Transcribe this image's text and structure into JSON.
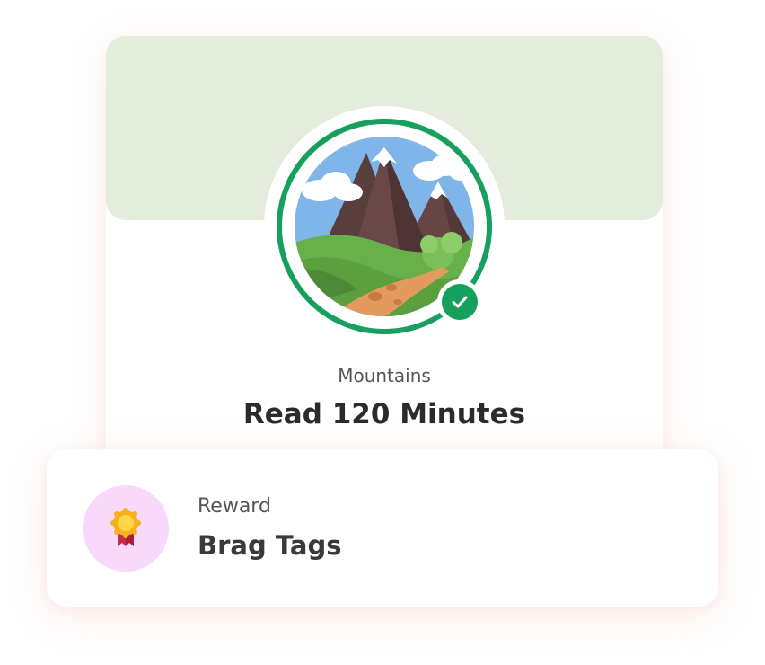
{
  "challenge": {
    "category": "Mountains",
    "title": "Read 120 Minutes",
    "completed": true
  },
  "reward": {
    "label": "Reward",
    "name": "Brag Tags"
  },
  "icons": {
    "badge": "mountains-badge-icon",
    "check": "checkmark-icon",
    "reward": "medal-icon"
  },
  "colors": {
    "banner": "#e4ecdc",
    "ring": "#17a05d",
    "reward_icon_bg": "#f8d8fb"
  }
}
